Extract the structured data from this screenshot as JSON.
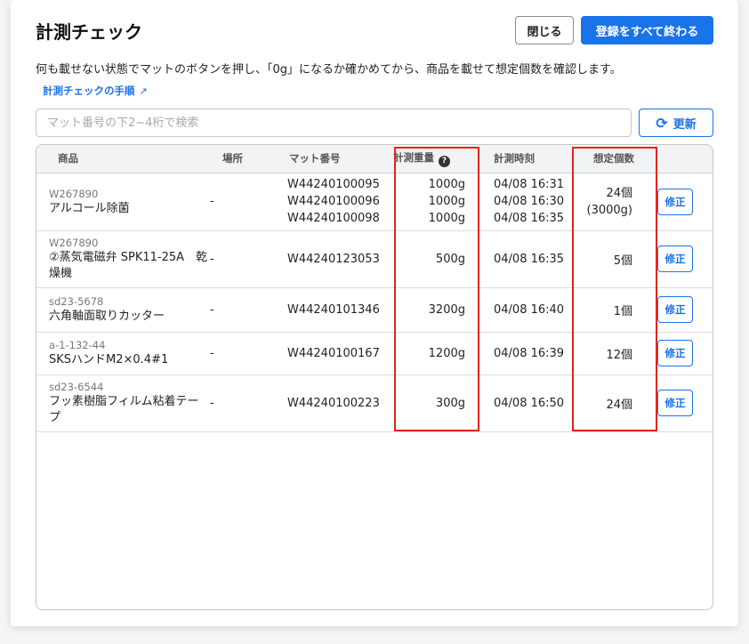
{
  "header": {
    "title": "計測チェック",
    "close_label": "閉じる",
    "finish_label": "登録をすべて終わる"
  },
  "description": "何も載せない状態でマットのボタンを押し、「0g」になるか確かめてから、商品を載せて想定個数を確認します。",
  "guide_link": {
    "label": "計測チェックの手順",
    "icon": "external-link-icon"
  },
  "search": {
    "placeholder": "マット番号の下2~4桁で検索",
    "value": ""
  },
  "refresh": {
    "label": "更新",
    "icon": "refresh-icon"
  },
  "table": {
    "columns": {
      "product": "商品",
      "place": "場所",
      "mat": "マット番号",
      "weight": "計測重量",
      "time": "計測時刻",
      "count": "想定個数"
    },
    "rows": [
      {
        "code": "W267890",
        "name": "アルコール除菌",
        "place": "-",
        "mats": [
          "W44240100095",
          "W44240100096",
          "W44240100098"
        ],
        "weights": [
          "1000g",
          "1000g",
          "1000g"
        ],
        "times": [
          "04/08 16:31",
          "04/08 16:30",
          "04/08 16:35"
        ],
        "count": [
          "24個",
          "(3000g)"
        ],
        "action": "修正"
      },
      {
        "code": "W267890",
        "name": "②蒸気電磁弁 SPK11-25A　乾燥機",
        "place": "-",
        "mats": [
          "W44240123053"
        ],
        "weights": [
          "500g"
        ],
        "times": [
          "04/08 16:35"
        ],
        "count": [
          "5個"
        ],
        "action": "修正"
      },
      {
        "code": "sd23-5678",
        "name": "六角軸面取りカッター",
        "place": "-",
        "mats": [
          "W44240101346"
        ],
        "weights": [
          "3200g"
        ],
        "times": [
          "04/08 16:40"
        ],
        "count": [
          "1個"
        ],
        "action": "修正"
      },
      {
        "code": "a-1-132-44",
        "name": "SKSハンドM2×0.4#1",
        "place": "-",
        "mats": [
          "W44240100167"
        ],
        "weights": [
          "1200g"
        ],
        "times": [
          "04/08 16:39"
        ],
        "count": [
          "12個"
        ],
        "action": "修正"
      },
      {
        "code": "sd23-6544",
        "name": "フッ素樹脂フィルム粘着テープ",
        "place": "-",
        "mats": [
          "W44240100223"
        ],
        "weights": [
          "300g"
        ],
        "times": [
          "04/08 16:50"
        ],
        "count": [
          "24個"
        ],
        "action": "修正"
      }
    ]
  },
  "colors": {
    "accent": "#1a73e8",
    "highlight": "#e0261a"
  }
}
